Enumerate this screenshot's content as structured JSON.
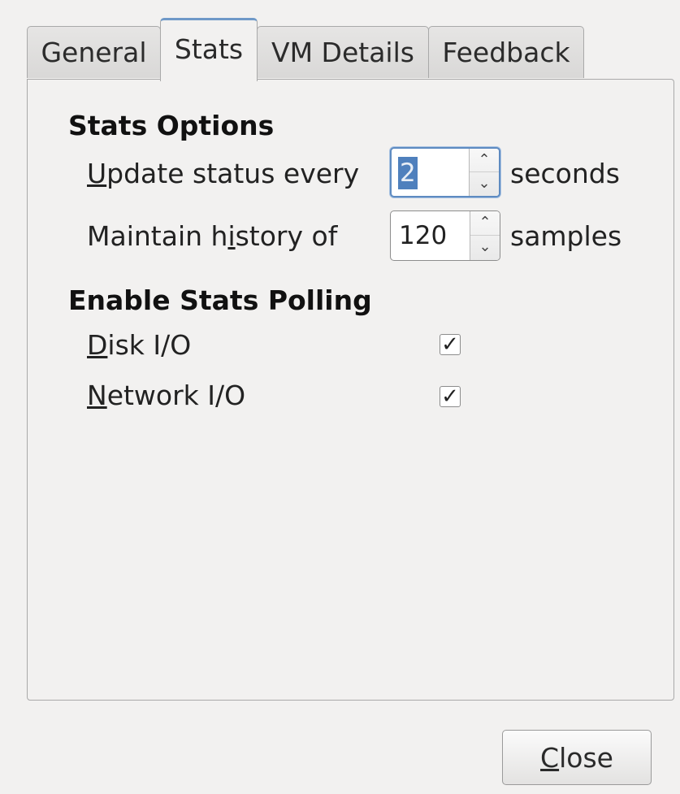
{
  "tabs": [
    {
      "label": "General",
      "active": false
    },
    {
      "label": "Stats",
      "active": true
    },
    {
      "label": "VM Details",
      "active": false
    },
    {
      "label": "Feedback",
      "active": false
    }
  ],
  "stats_options": {
    "heading": "Stats Options",
    "update": {
      "label_mnemonic": "U",
      "label_rest": "pdate status every",
      "value": "2",
      "unit": "seconds"
    },
    "history": {
      "label_pre": "Maintain h",
      "label_mnemonic": "i",
      "label_post": "story of",
      "value": "120",
      "unit": "samples"
    }
  },
  "polling": {
    "heading": "Enable Stats Polling",
    "disk": {
      "label_mnemonic": "D",
      "label_rest": "isk I/O",
      "checked": true
    },
    "network": {
      "label_mnemonic": "N",
      "label_rest": "etwork I/O",
      "checked": true
    }
  },
  "check_glyph": "✓",
  "spin_up_glyph": "⌃",
  "spin_down_glyph": "⌄",
  "close_button": {
    "label_mnemonic": "C",
    "label_rest": "lose"
  },
  "colors": {
    "focus_ring": "#5e8bc1",
    "selection": "#4f80bd",
    "active_tab_accent": "#6f99c8"
  }
}
